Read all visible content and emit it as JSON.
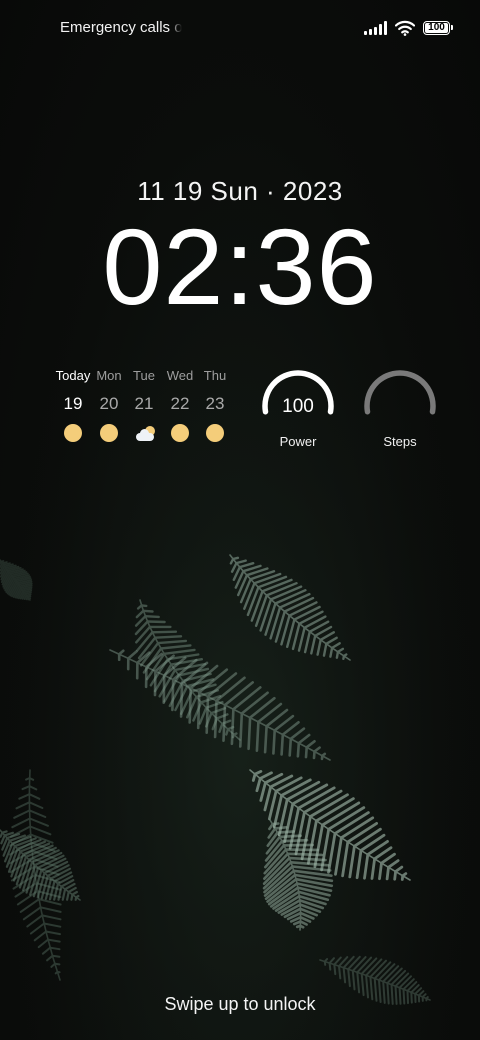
{
  "status_bar": {
    "carrier_text": "Emergency calls only",
    "battery_level": "100"
  },
  "lockscreen": {
    "date": "11 19 Sun · 2023",
    "time": "02:36",
    "swipe_hint": "Swipe up to unlock"
  },
  "weather": {
    "days": [
      {
        "name": "Today",
        "date": "19",
        "icon": "sun-icon"
      },
      {
        "name": "Mon",
        "date": "20",
        "icon": "sun-icon"
      },
      {
        "name": "Tue",
        "date": "21",
        "icon": "partly-cloudy-icon"
      },
      {
        "name": "Wed",
        "date": "22",
        "icon": "sun-icon"
      },
      {
        "name": "Thu",
        "date": "23",
        "icon": "sun-icon"
      }
    ],
    "sun_color": "#f4cd7a"
  },
  "widgets": {
    "power": {
      "value": "100",
      "label": "Power",
      "level": 1.0
    },
    "steps": {
      "label": "Steps",
      "level": 0.0
    }
  }
}
